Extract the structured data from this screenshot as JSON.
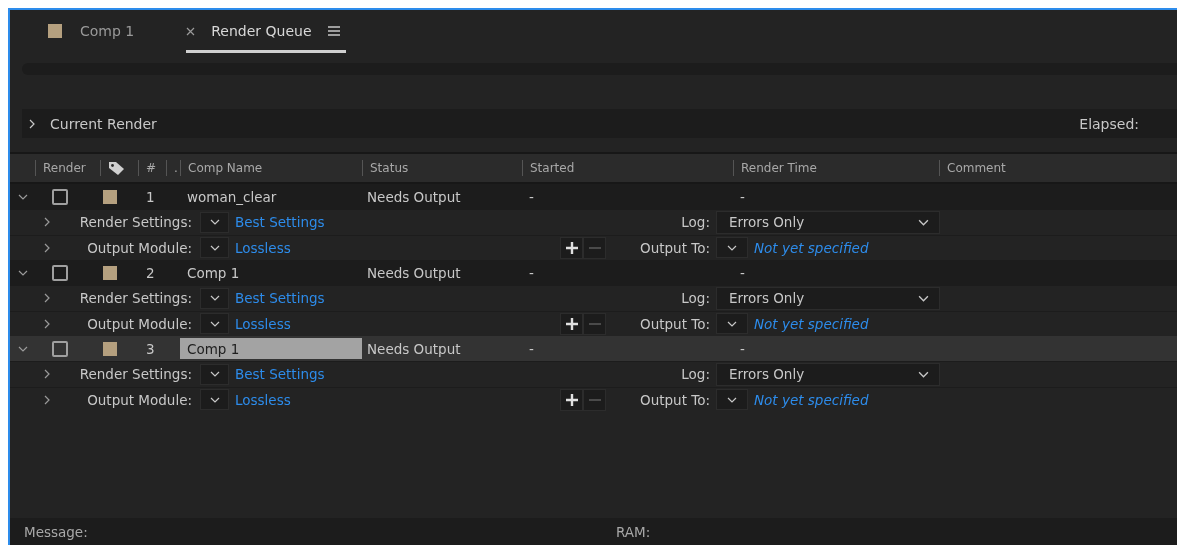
{
  "tabs": [
    {
      "label": "Comp 1",
      "selected": false,
      "color": "#b5a07f",
      "closable": false,
      "menu": false
    },
    {
      "label": "Render Queue",
      "selected": true,
      "closable": true,
      "menu": true
    }
  ],
  "current_render": {
    "label": "Current Render",
    "expanded": false,
    "elapsed_label": "Elapsed:"
  },
  "columns": [
    "Render",
    "",
    "#",
    ".",
    "Comp Name",
    "Status",
    "Started",
    "Render Time",
    "Comment"
  ],
  "items": [
    {
      "number": "1",
      "comp_name": "woman_clear",
      "status": "Needs Output",
      "started": "-",
      "render_time": "-",
      "selected": false,
      "checked": false,
      "expanded": true,
      "color": "#b5a07f",
      "render_settings": {
        "label": "Render Settings:",
        "value": "Best Settings",
        "expanded": false,
        "log_label": "Log:",
        "log_value": "Errors Only"
      },
      "output_module": {
        "label": "Output Module:",
        "value": "Lossless",
        "expanded": false,
        "output_to_label": "Output To:",
        "output_to_value": "Not yet specified"
      }
    },
    {
      "number": "2",
      "comp_name": "Comp 1",
      "status": "Needs Output",
      "started": "-",
      "render_time": "-",
      "selected": false,
      "checked": false,
      "expanded": true,
      "color": "#b5a07f",
      "render_settings": {
        "label": "Render Settings:",
        "value": "Best Settings",
        "expanded": false,
        "log_label": "Log:",
        "log_value": "Errors Only"
      },
      "output_module": {
        "label": "Output Module:",
        "value": "Lossless",
        "expanded": false,
        "output_to_label": "Output To:",
        "output_to_value": "Not yet specified"
      }
    },
    {
      "number": "3",
      "comp_name": "Comp 1",
      "status": "Needs Output",
      "started": "-",
      "render_time": "-",
      "selected": true,
      "checked": false,
      "expanded": true,
      "color": "#b5a07f",
      "render_settings": {
        "label": "Render Settings:",
        "value": "Best Settings",
        "expanded": false,
        "log_label": "Log:",
        "log_value": "Errors Only"
      },
      "output_module": {
        "label": "Output Module:",
        "value": "Lossless",
        "expanded": false,
        "output_to_label": "Output To:",
        "output_to_value": "Not yet specified"
      }
    }
  ],
  "status_bar": {
    "message_label": "Message:",
    "ram_label": "RAM:"
  }
}
